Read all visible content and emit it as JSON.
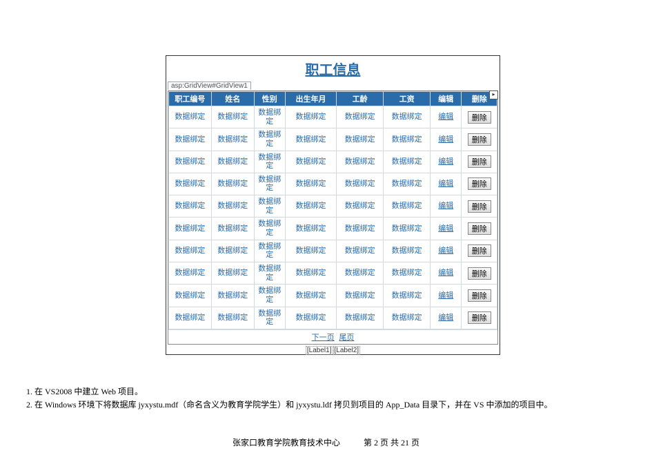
{
  "title": "职工信息",
  "designer_tag": "asp:GridView#GridView1",
  "smart_glyph": "▸",
  "columns": [
    "职工编号",
    "姓名",
    "性别",
    "出生年月",
    "工龄",
    "工资",
    "编辑",
    "删除"
  ],
  "bound_text": "数据绑定",
  "bound_text_wrap": "数据绑\n定",
  "edit_label": "编辑",
  "delete_label": "删除",
  "row_count": 10,
  "pager": {
    "next": "下一页",
    "last": "尾页"
  },
  "labels": [
    "[Label1]",
    "[Label2]"
  ],
  "instructions": [
    "在 VS2008 中建立 Web 项目。",
    "在 Windows 环境下将数据库 jyxystu.mdf（命名含义为教育学院学生）和 jyxystu.ldf 拷贝到项目的 App_Data 目录下，并在 VS 中添加的项目中。"
  ],
  "footer": {
    "org": "张家口教育学院教育技术中心",
    "page_label_a": "第",
    "page_current": "2",
    "page_label_b": "页  共",
    "page_total": "21",
    "page_label_c": "页"
  }
}
